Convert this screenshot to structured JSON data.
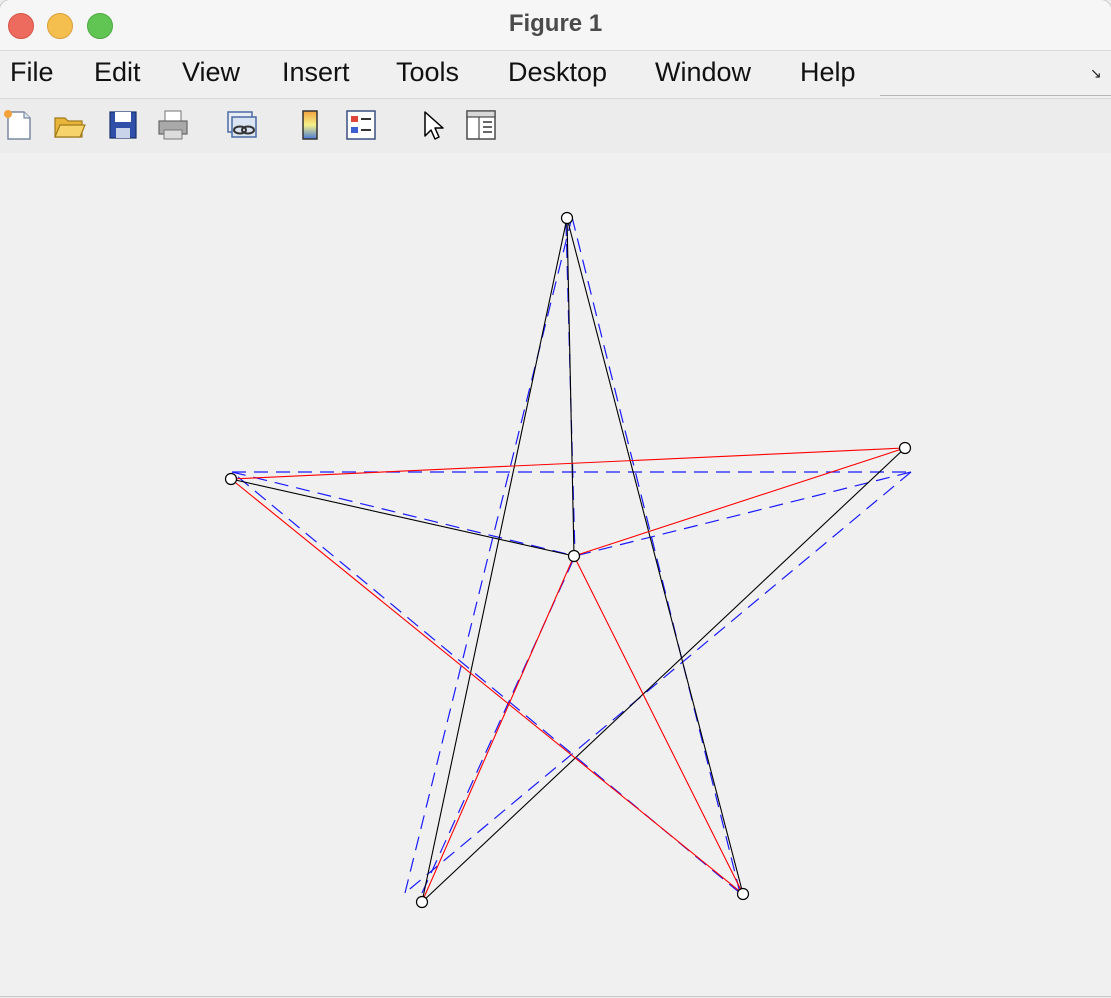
{
  "window": {
    "title": "Figure 1"
  },
  "menubar": {
    "items": [
      "File",
      "Edit",
      "View",
      "Insert",
      "Tools",
      "Desktop",
      "Window",
      "Help"
    ]
  },
  "toolbar": {
    "icons": [
      "new-figure-icon",
      "open-file-icon",
      "save-icon",
      "print-icon",
      "link-plot-icon",
      "colorbar-icon",
      "legend-icon",
      "pointer-icon",
      "property-editor-icon"
    ]
  },
  "colors": {
    "black_series": "#000000",
    "red_series": "#ff0000",
    "blue_dashed_series": "#0000ff"
  }
}
